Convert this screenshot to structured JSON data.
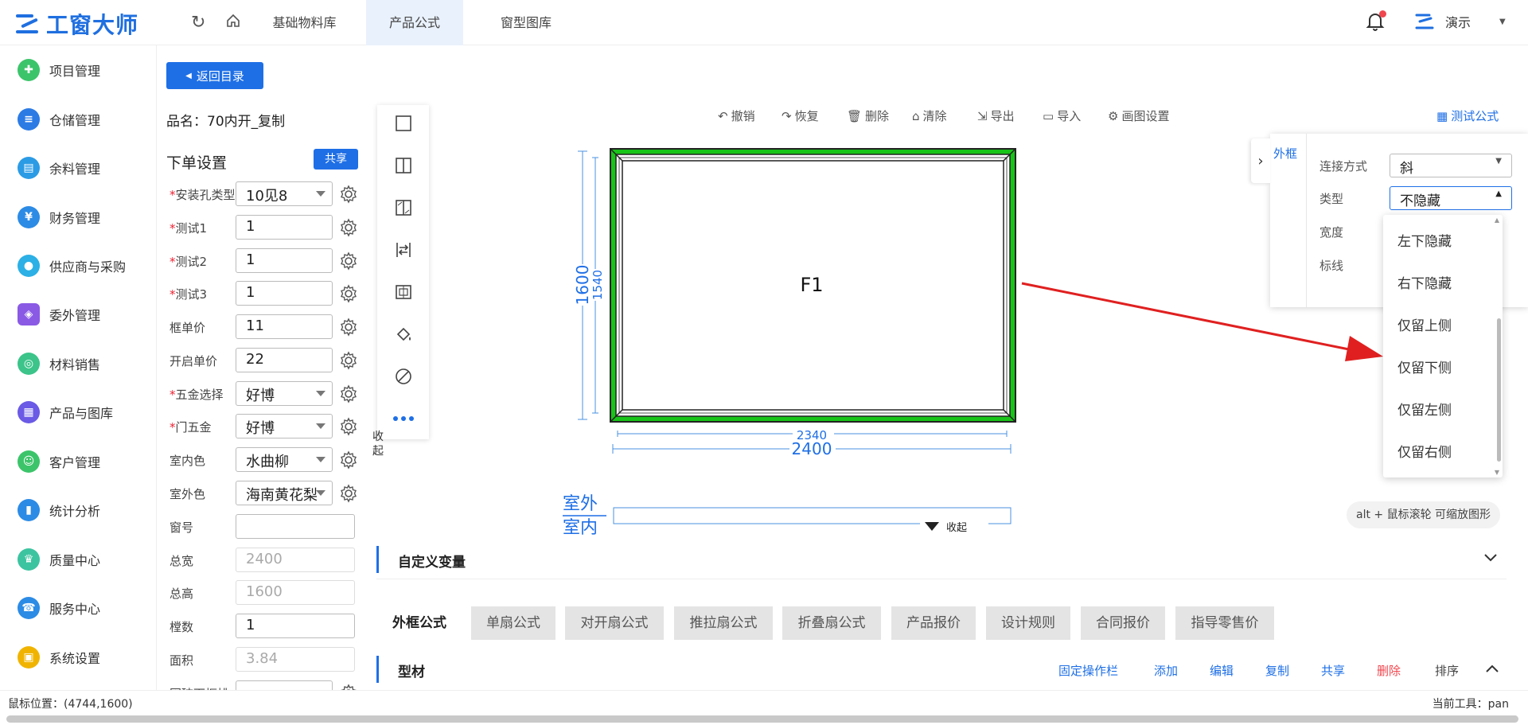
{
  "app": {
    "name": "工窗大师"
  },
  "topnav": {
    "tabs": [
      {
        "label": "基础物料库"
      },
      {
        "label": "产品公式",
        "active": true
      },
      {
        "label": "窗型图库"
      }
    ],
    "user": "演示"
  },
  "sidebar": {
    "items": [
      {
        "label": "项目管理",
        "color": "#3cc46a"
      },
      {
        "label": "仓储管理",
        "color": "#2c7be5"
      },
      {
        "label": "余料管理",
        "color": "#2c9be5"
      },
      {
        "label": "财务管理",
        "color": "#2c8be5"
      },
      {
        "label": "供应商与采购",
        "color": "#2cb0e5"
      },
      {
        "label": "委外管理",
        "color": "#8a5ae5"
      },
      {
        "label": "材料销售",
        "color": "#3cc48a"
      },
      {
        "label": "产品与图库",
        "color": "#6a5ae5"
      },
      {
        "label": "客户管理",
        "color": "#3cc46a"
      },
      {
        "label": "统计分析",
        "color": "#2c8be5"
      },
      {
        "label": "质量中心",
        "color": "#3cc4a0"
      },
      {
        "label": "服务中心",
        "color": "#2c8be5"
      },
      {
        "label": "系统设置",
        "color": "#f0b400"
      }
    ]
  },
  "form": {
    "back_label": "返回目录",
    "product_name": "品名：70内开_复制",
    "order_title": "下单设置",
    "share_label": "共享",
    "rows": [
      {
        "label": "安装孔类型",
        "value": "10见8",
        "required": true,
        "type": "select"
      },
      {
        "label": "测试1",
        "value": "1",
        "required": true,
        "type": "input"
      },
      {
        "label": "测试2",
        "value": "1",
        "required": true,
        "type": "input"
      },
      {
        "label": "测试3",
        "value": "1",
        "required": true,
        "type": "input"
      },
      {
        "label": "框单价",
        "value": "11",
        "required": false,
        "type": "input"
      },
      {
        "label": "开启单价",
        "value": "22",
        "required": false,
        "type": "input"
      },
      {
        "label": "五金选择",
        "value": "好博",
        "required": true,
        "type": "select"
      },
      {
        "label": "门五金",
        "value": "好博",
        "required": true,
        "type": "select"
      },
      {
        "label": "室内色",
        "value": "水曲柳",
        "required": false,
        "type": "select"
      },
      {
        "label": "室外色",
        "value": "海南黄花梨",
        "required": false,
        "type": "select"
      },
      {
        "label": "窗号",
        "value": "",
        "required": false,
        "type": "wide"
      },
      {
        "label": "总宽",
        "value": "2400",
        "required": false,
        "type": "disabled"
      },
      {
        "label": "总高",
        "value": "1600",
        "required": false,
        "type": "disabled"
      },
      {
        "label": "樘数",
        "value": "1",
        "required": false,
        "type": "wide"
      },
      {
        "label": "面积",
        "value": "3.84",
        "required": false,
        "type": "disabled"
      },
      {
        "label": "固玻下框排",
        "value": "",
        "required": false,
        "type": "select"
      }
    ]
  },
  "vtoolbar": {
    "collapse_label": "收起"
  },
  "canvas_toolbar": {
    "undo": "撤销",
    "redo": "恢复",
    "delete": "删除",
    "clear": "清除",
    "export": "导出",
    "import": "导入",
    "settings": "画图设置",
    "test_formula": "测试公式"
  },
  "drawing": {
    "panel_label": "F1",
    "dim_inner_width": "2340",
    "dim_outer_width": "2400",
    "dim_outer_height": "1600",
    "dim_inner_height": "1540",
    "outside_label": "室外",
    "inside_label": "室内",
    "collapse_label": "收起",
    "frame_color": "#19c419"
  },
  "right_panel": {
    "tab": "外框",
    "connection_label": "连接方式",
    "connection_value": "斜",
    "type_label": "类型",
    "type_value": "不隐藏",
    "width_label": "宽度",
    "line_label": "标线"
  },
  "dropdown": {
    "options": [
      "左下隐藏",
      "右下隐藏",
      "仅留上侧",
      "仅留下侧",
      "仅留左侧",
      "仅留右侧"
    ]
  },
  "hint": "alt + 鼠标滚轮 可缩放图形",
  "custom_var": {
    "title": "自定义变量"
  },
  "formula_tabs": [
    "外框公式",
    "单扇公式",
    "对开扇公式",
    "推拉扇公式",
    "折叠扇公式",
    "产品报价",
    "设计规则",
    "合同报价",
    "指导零售价"
  ],
  "profile": {
    "title": "型材",
    "actions": [
      "固定操作栏",
      "添加",
      "编辑",
      "复制",
      "共享",
      "删除",
      "排序"
    ]
  },
  "status": {
    "mouse_pos": "鼠标位置：(4744,1600)",
    "current_tool": "当前工具：pan"
  }
}
